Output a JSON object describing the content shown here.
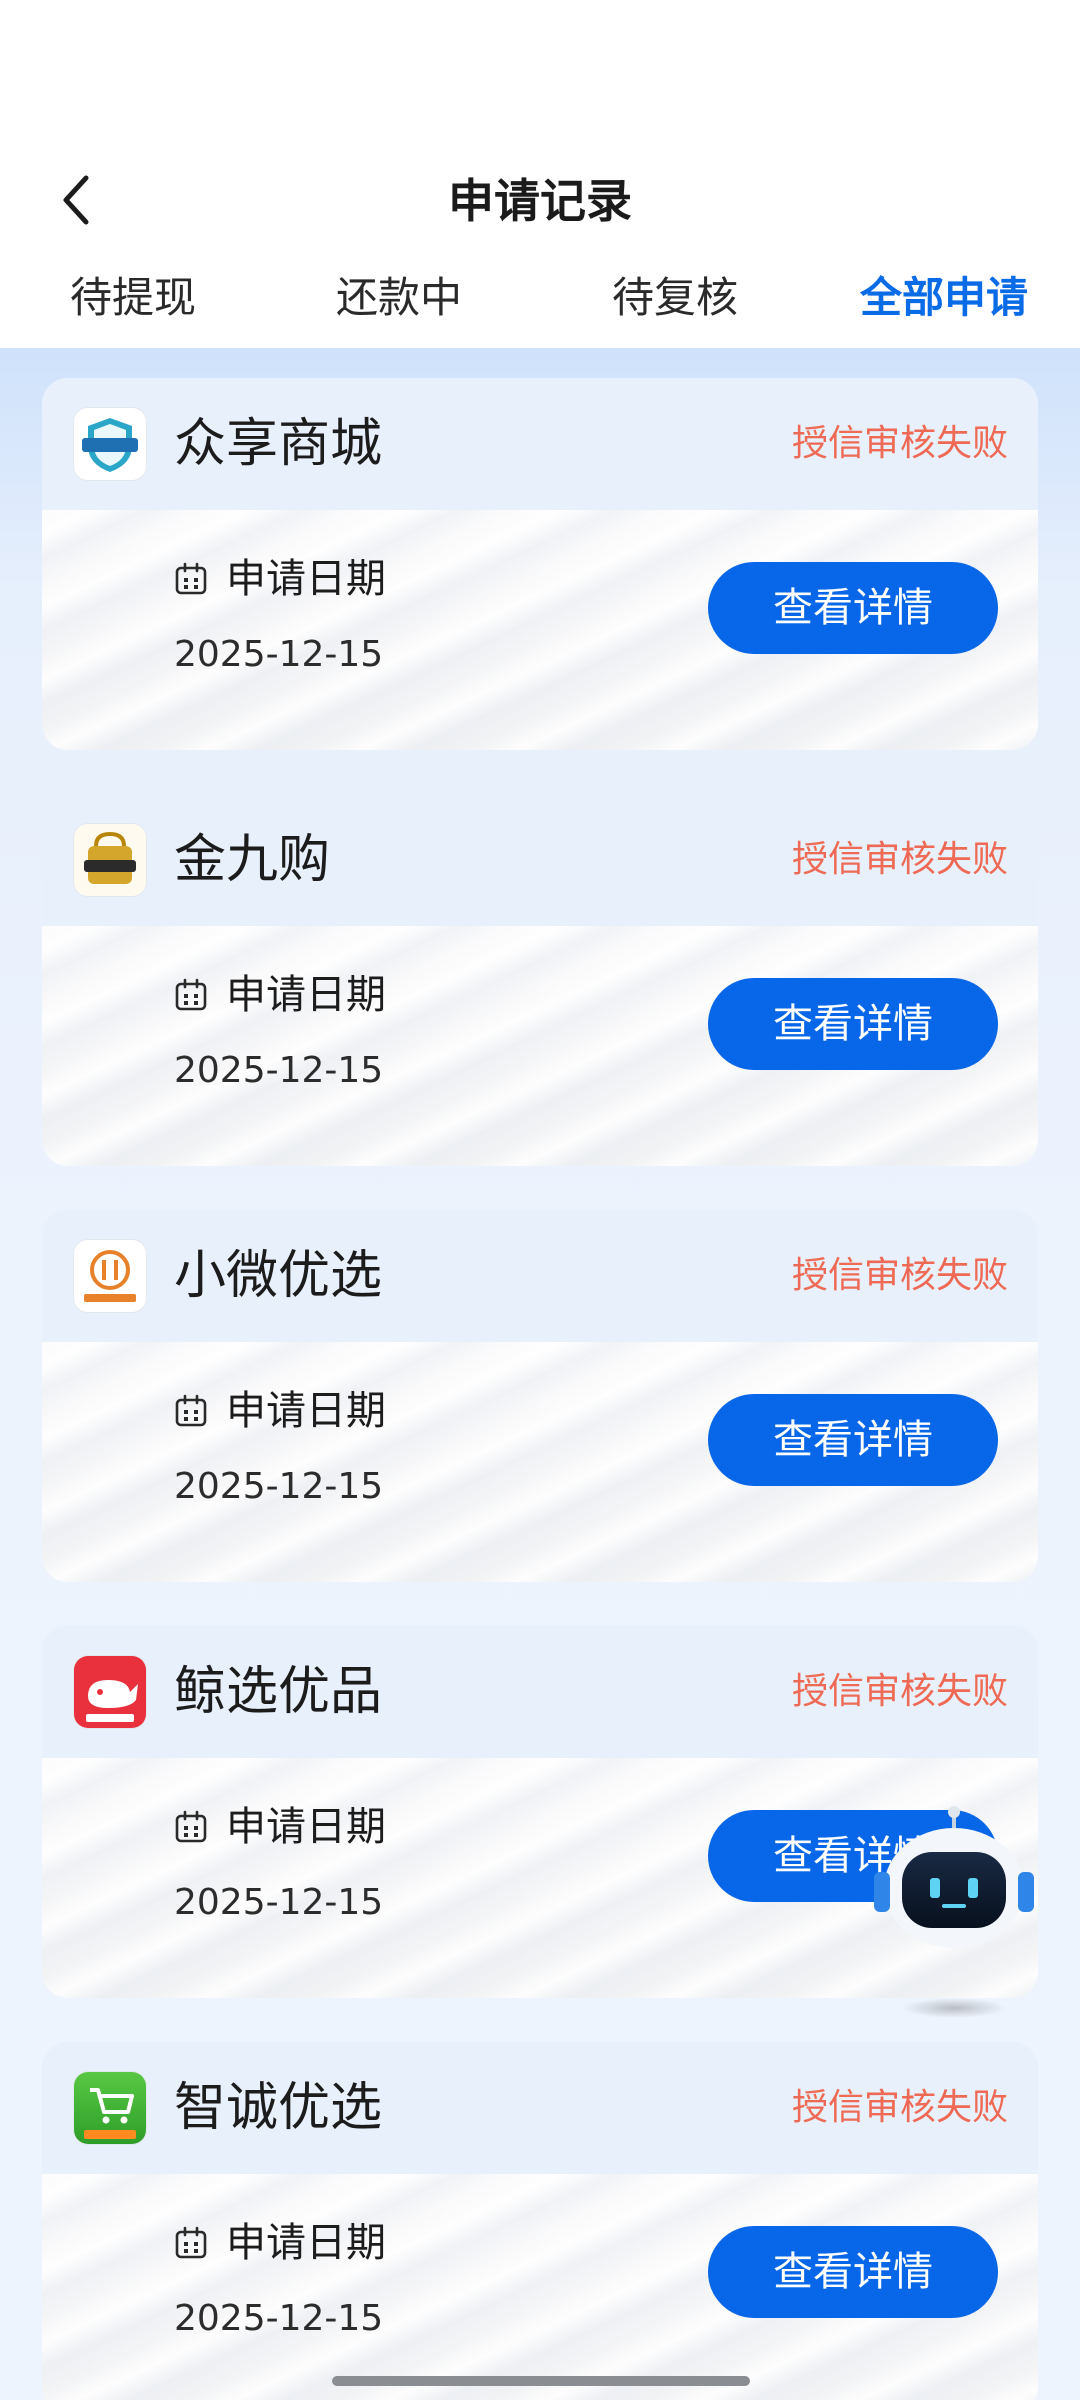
{
  "header": {
    "title": "申请记录",
    "back_icon": "chevron-left-icon"
  },
  "tabs": [
    {
      "label": "待提现",
      "active": false
    },
    {
      "label": "还款中",
      "active": false
    },
    {
      "label": "待复核",
      "active": false
    },
    {
      "label": "全部申请",
      "active": true
    }
  ],
  "colors": {
    "accent": "#0A6BE6",
    "button": "#0867E8",
    "status_failed": "#EF6A55",
    "page_bg": "#EEF4FD"
  },
  "applications": [
    {
      "name": "众享商城",
      "logo_icon": "zhongxiang-mall-logo-icon",
      "logo_text": "众享商城",
      "status": "授信审核失败",
      "date_label": "申请日期",
      "date": "2025-12-15",
      "button": "查看详情"
    },
    {
      "name": "金九购",
      "logo_icon": "jinjiugou-logo-icon",
      "logo_text": "金九购",
      "status": "授信审核失败",
      "date_label": "申请日期",
      "date": "2025-12-15",
      "button": "查看详情"
    },
    {
      "name": "小微优选",
      "logo_icon": "xiaowei-logo-icon",
      "logo_text": "小微优选",
      "status": "授信审核失败",
      "date_label": "申请日期",
      "date": "2025-12-15",
      "button": "查看详情"
    },
    {
      "name": "鲸选优品",
      "logo_icon": "whale-logo-icon",
      "logo_text": "鲸选优品",
      "status": "授信审核失败",
      "date_label": "申请日期",
      "date": "2025-12-15",
      "button": "查看详情"
    },
    {
      "name": "智诚优选",
      "logo_icon": "cart-logo-icon",
      "logo_text": "智诚优选",
      "status": "授信审核失败",
      "date_label": "申请日期",
      "date": "2025-12-15",
      "button": "查看详情"
    }
  ],
  "floating": {
    "icon": "robot-assistant-icon"
  }
}
